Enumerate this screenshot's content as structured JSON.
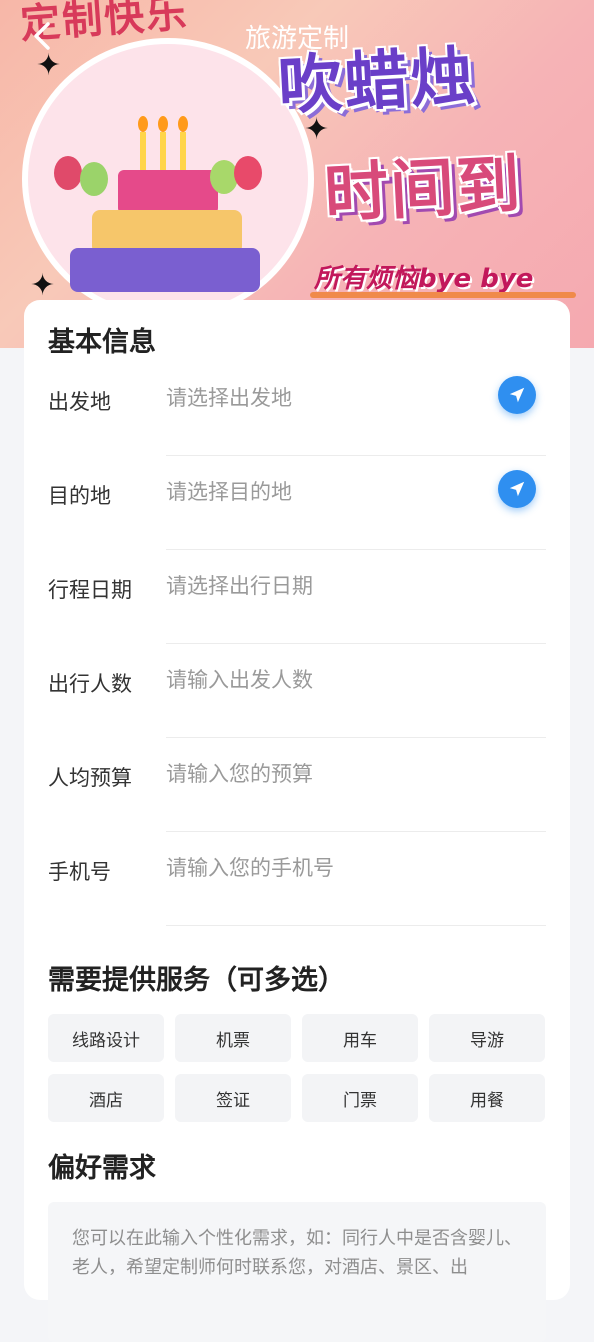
{
  "banner": {
    "topline": "定制快乐",
    "title_line1": "吹蜡烛",
    "title_line2": "时间到",
    "subtitle": "所有烦恼bye bye"
  },
  "navbar": {
    "title": "旅游定制",
    "back_icon": "chevron-left-icon"
  },
  "basic_info": {
    "title": "基本信息",
    "fields": [
      {
        "label": "出发地",
        "placeholder": "请选择出发地",
        "icon": "location-arrow-icon"
      },
      {
        "label": "目的地",
        "placeholder": "请选择目的地",
        "icon": "location-arrow-icon"
      },
      {
        "label": "行程日期",
        "placeholder": "请选择出行日期"
      },
      {
        "label": "出行人数",
        "placeholder": "请输入出发人数"
      },
      {
        "label": "人均预算",
        "placeholder": "请输入您的预算"
      },
      {
        "label": "手机号",
        "placeholder": "请输入您的手机号"
      }
    ]
  },
  "services": {
    "title": "需要提供服务（可多选）",
    "options": [
      "线路设计",
      "机票",
      "用车",
      "导游",
      "酒店",
      "签证",
      "门票",
      "用餐"
    ]
  },
  "preferences": {
    "title": "偏好需求",
    "placeholder": "您可以在此输入个性化需求，如：同行人中是否含婴儿、老人，希望定制师何时联系您，对酒店、景区、出"
  },
  "colors": {
    "accent": "#2f8ff0",
    "background": "#f4f5f8"
  }
}
